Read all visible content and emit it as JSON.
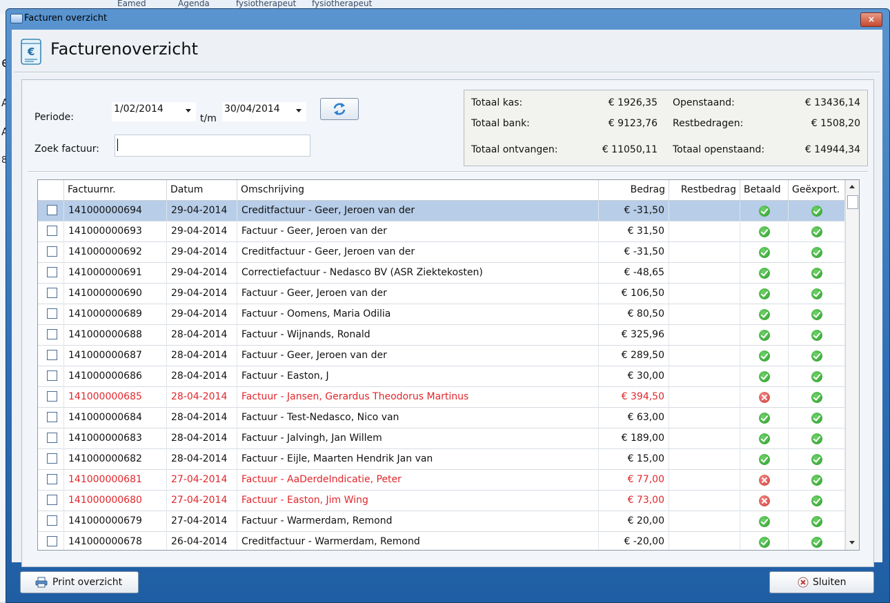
{
  "background": {
    "tabs": [
      "Eamed",
      "Agenda",
      "fysiotherapeut",
      "fysiotherapeut"
    ],
    "left_fragments": [
      "e",
      "A",
      "A",
      "8"
    ]
  },
  "window": {
    "title": "Facturen overzicht",
    "close": "×"
  },
  "header": {
    "title": "Facturenoverzicht",
    "icon": "invoice-euro-icon"
  },
  "filters": {
    "periode_label": "Periode:",
    "from_date": "1/02/2014",
    "to_label": "t/m",
    "to_date": "30/04/2014",
    "search_label": "Zoek factuur:",
    "search_value": ""
  },
  "totals": {
    "kas_label": "Totaal kas:",
    "kas_value": "€ 1926,35",
    "bank_label": "Totaal bank:",
    "bank_value": "€ 9123,76",
    "ontvangen_label": "Totaal ontvangen:",
    "ontvangen_value": "€ 11050,11",
    "openstaand_label": "Openstaand:",
    "openstaand_value": "€ 13436,14",
    "rest_label": "Restbedragen:",
    "rest_value": "€ 1508,20",
    "totaal_open_label": "Totaal openstaand:",
    "totaal_open_value": "€ 14944,34"
  },
  "table": {
    "columns": [
      "Factuurnr.",
      "Datum",
      "Omschrijving",
      "Bedrag",
      "Restbedrag",
      "Betaald",
      "Geëxport."
    ],
    "rows": [
      {
        "nr": "141000000694",
        "datum": "29-04-2014",
        "oms": "Creditfactuur - Geer, Jeroen van der",
        "bedrag": "€ -31,50",
        "rest": "",
        "paid": true,
        "exp": true,
        "red": false,
        "sel": true
      },
      {
        "nr": "141000000693",
        "datum": "29-04-2014",
        "oms": "Factuur - Geer, Jeroen van der",
        "bedrag": "€ 31,50",
        "rest": "",
        "paid": true,
        "exp": true,
        "red": false
      },
      {
        "nr": "141000000692",
        "datum": "29-04-2014",
        "oms": "Creditfactuur - Geer, Jeroen van der",
        "bedrag": "€ -31,50",
        "rest": "",
        "paid": true,
        "exp": true,
        "red": false
      },
      {
        "nr": "141000000691",
        "datum": "29-04-2014",
        "oms": "Correctiefactuur - Nedasco BV (ASR Ziektekosten)",
        "bedrag": "€ -48,65",
        "rest": "",
        "paid": true,
        "exp": true,
        "red": false
      },
      {
        "nr": "141000000690",
        "datum": "29-04-2014",
        "oms": "Factuur - Geer, Jeroen van der",
        "bedrag": "€ 106,50",
        "rest": "",
        "paid": true,
        "exp": true,
        "red": false
      },
      {
        "nr": "141000000689",
        "datum": "29-04-2014",
        "oms": "Factuur - Oomens, Maria Odilia",
        "bedrag": "€ 80,50",
        "rest": "",
        "paid": true,
        "exp": true,
        "red": false
      },
      {
        "nr": "141000000688",
        "datum": "28-04-2014",
        "oms": "Factuur - Wijnands, Ronald",
        "bedrag": "€ 325,96",
        "rest": "",
        "paid": true,
        "exp": true,
        "red": false
      },
      {
        "nr": "141000000687",
        "datum": "28-04-2014",
        "oms": "Factuur - Geer, Jeroen van der",
        "bedrag": "€ 289,50",
        "rest": "",
        "paid": true,
        "exp": true,
        "red": false
      },
      {
        "nr": "141000000686",
        "datum": "28-04-2014",
        "oms": "Factuur - Easton, J",
        "bedrag": "€ 30,00",
        "rest": "",
        "paid": true,
        "exp": true,
        "red": false
      },
      {
        "nr": "141000000685",
        "datum": "28-04-2014",
        "oms": "Factuur - Jansen, Gerardus Theodorus Martinus",
        "bedrag": "€ 394,50",
        "rest": "",
        "paid": false,
        "exp": true,
        "red": true
      },
      {
        "nr": "141000000684",
        "datum": "28-04-2014",
        "oms": "Factuur - Test-Nedasco, Nico van",
        "bedrag": "€ 63,00",
        "rest": "",
        "paid": true,
        "exp": true,
        "red": false
      },
      {
        "nr": "141000000683",
        "datum": "28-04-2014",
        "oms": "Factuur - Jalvingh, Jan Willem",
        "bedrag": "€ 189,00",
        "rest": "",
        "paid": true,
        "exp": true,
        "red": false
      },
      {
        "nr": "141000000682",
        "datum": "28-04-2014",
        "oms": "Factuur - Eijle, Maarten Hendrik Jan van",
        "bedrag": "€ 15,00",
        "rest": "",
        "paid": true,
        "exp": true,
        "red": false
      },
      {
        "nr": "141000000681",
        "datum": "27-04-2014",
        "oms": "Factuur - AaDerdeIndicatie, Peter",
        "bedrag": "€ 77,00",
        "rest": "",
        "paid": false,
        "exp": true,
        "red": true
      },
      {
        "nr": "141000000680",
        "datum": "27-04-2014",
        "oms": "Factuur - Easton, Jim Wing",
        "bedrag": "€ 73,00",
        "rest": "",
        "paid": false,
        "exp": true,
        "red": true
      },
      {
        "nr": "141000000679",
        "datum": "27-04-2014",
        "oms": "Factuur - Warmerdam, Remond",
        "bedrag": "€ 20,00",
        "rest": "",
        "paid": true,
        "exp": true,
        "red": false
      },
      {
        "nr": "141000000678",
        "datum": "26-04-2014",
        "oms": "Creditfactuur - Warmerdam, Remond",
        "bedrag": "€ -20,00",
        "rest": "",
        "paid": true,
        "exp": true,
        "red": false
      }
    ]
  },
  "buttons": {
    "print": "Print overzicht",
    "close": "Sluiten"
  },
  "colors": {
    "selected_row": "#b7cde8",
    "unpaid_text": "#e1262b",
    "paid_green": "#2c9a2a",
    "unpaid_red": "#cf3b37"
  }
}
